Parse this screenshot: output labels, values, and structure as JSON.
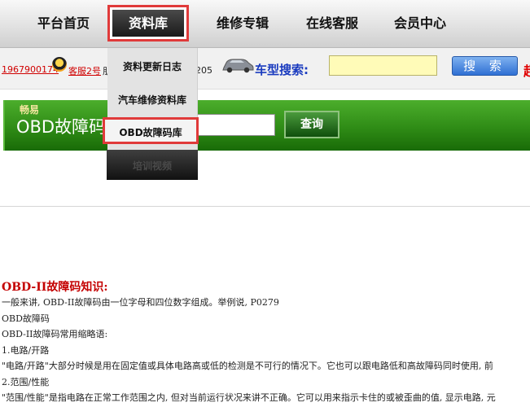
{
  "nav": {
    "items": [
      "平台首页",
      "资料库",
      "维修专辑",
      "在线客服",
      "会员中心"
    ]
  },
  "infobar": {
    "phone": "1967900174",
    "kefu": "客服2号",
    "kefu_tail": "朋",
    "number": "205",
    "car_search_label": "车型搜索:",
    "search_placeholder": "",
    "search_button": "搜 索",
    "red_char": "超"
  },
  "dropdown": {
    "items": [
      "资料更新日志",
      "汽车维修资料库",
      "OBD故障码库",
      "培训视频"
    ]
  },
  "banner": {
    "subtitle": "畅易",
    "title": "OBD故障码",
    "query_button": "查询"
  },
  "content": {
    "heading": "OBD-II故障码知识:",
    "lines": [
      "一般来讲, OBD-II故障码由一位字母和四位数字组成。举例说, P0279",
      "OBD故障码",
      "OBD-II故障码常用缩略语:",
      "1.电路/开路",
      "\"电路/开路\"大部分时候是用在固定值或具体电路高或低的检测是不可行的情况下。它也可以跟电路低和高故障码同时使用, 前",
      "2.范围/性能",
      "\"范围/性能\"是指电路在正常工作范围之内, 但对当前运行状况来讲不正确。它可以用来指示卡住的或被歪曲的值, 显示电路, 元"
    ]
  },
  "colors": {
    "highlight_border": "#e03a3a",
    "banner_green": "#2f8c16",
    "heading_red": "#c40000",
    "link_red": "#d00000",
    "car_label_blue": "#1a3bbf"
  },
  "icons": [
    "qq-penguin-icon",
    "car-icon"
  ]
}
